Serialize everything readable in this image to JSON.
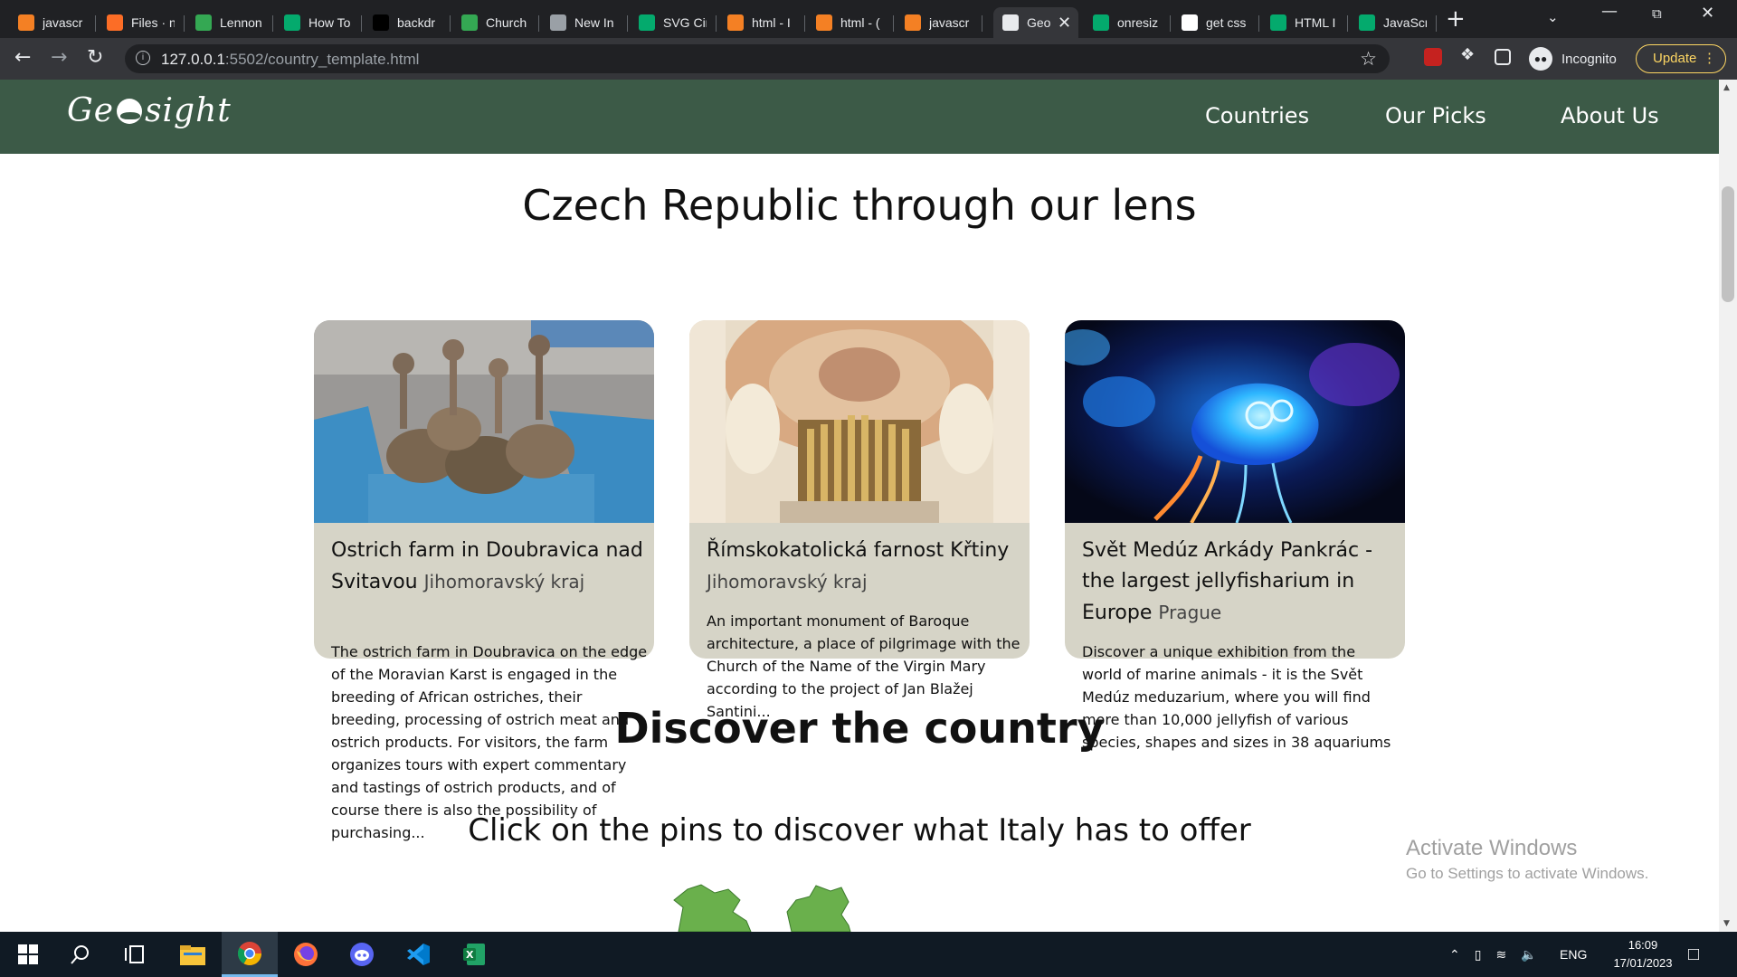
{
  "browser": {
    "tabs": [
      {
        "title": "javascr",
        "icon": "stackoverflow-icon",
        "color": "#f48024"
      },
      {
        "title": "Files · n",
        "icon": "gitlab-icon",
        "color": "#fc6d26"
      },
      {
        "title": "Lennon",
        "icon": "pinwheel-icon",
        "color": "#34a853"
      },
      {
        "title": "How To",
        "icon": "w3schools-icon",
        "color": "#04aa6d"
      },
      {
        "title": "backdr",
        "icon": "mdn-icon",
        "color": "#000000"
      },
      {
        "title": "Church",
        "icon": "pinwheel-icon",
        "color": "#34a853"
      },
      {
        "title": "New In",
        "icon": "incognito-icon",
        "color": "#9aa0a6"
      },
      {
        "title": "SVG Cir",
        "icon": "w3schools-icon",
        "color": "#04aa6d"
      },
      {
        "title": "html - I",
        "icon": "stackoverflow-icon",
        "color": "#f48024"
      },
      {
        "title": "html - (",
        "icon": "stackoverflow-icon",
        "color": "#f48024"
      },
      {
        "title": "javascr",
        "icon": "stackoverflow-icon",
        "color": "#f48024"
      },
      {
        "title": "Geo",
        "icon": "globe-icon",
        "color": "#e8eaed",
        "active": true
      },
      {
        "title": "onresiz",
        "icon": "w3schools-icon",
        "color": "#04aa6d"
      },
      {
        "title": "get css",
        "icon": "google-icon",
        "color": "#ffffff"
      },
      {
        "title": "HTML I",
        "icon": "w3schools-icon",
        "color": "#04aa6d"
      },
      {
        "title": "JavaScr",
        "icon": "w3schools-icon",
        "color": "#04aa6d"
      }
    ],
    "url_host": "127.0.0.1",
    "url_rest": ":5502/country_template.html",
    "incognito_label": "Incognito",
    "update_label": "Update"
  },
  "site": {
    "nav_links": [
      "Countries",
      "Our Picks",
      "About Us"
    ],
    "page_title": "Czech Republic through our lens",
    "cards": [
      {
        "title": "Ostrich farm in Doubravica nad Svitavou",
        "region": "Jihomoravský kraj",
        "description": "The ostrich farm in Doubravica on the edge of the Moravian Karst is engaged in the breeding of African ostriches, their breeding, processing of ostrich meat and ostrich products. For visitors, the farm organizes tours with expert commentary and tastings of ostrich products, and of course there is also the possibility of purchasing..."
      },
      {
        "title": "Římskokatolická farnost Křtiny",
        "region": "Jihomoravský kraj",
        "description": "An important monument of Baroque architecture, a place of pilgrimage with the Church of the Name of the Virgin Mary according to the project of Jan Blažej Santini..."
      },
      {
        "title": "Svět Medúz Arkády Pankrác - the largest jellyfisharium in Europe",
        "region": "Prague",
        "description": "Discover a unique exhibition from the world of marine animals - it is the Svět Medúz meduzarium, where you will find more than 10,000 jellyfish of various species, shapes and sizes in 38 aquariums"
      }
    ],
    "discover_title": "Discover the country",
    "discover_subtitle": "Click on the pins to discover what Italy has to offer"
  },
  "windows_watermark": {
    "title": "Activate Windows",
    "subtitle": "Go to Settings to activate Windows."
  },
  "taskbar": {
    "apps": [
      "windows-start-icon",
      "search-icon",
      "task-view-icon",
      "file-explorer-icon",
      "chrome-icon",
      "firefox-icon",
      "discord-icon",
      "vscode-icon",
      "excel-icon"
    ],
    "language": "ENG",
    "time": "16:09",
    "date": "17/01/2023"
  }
}
